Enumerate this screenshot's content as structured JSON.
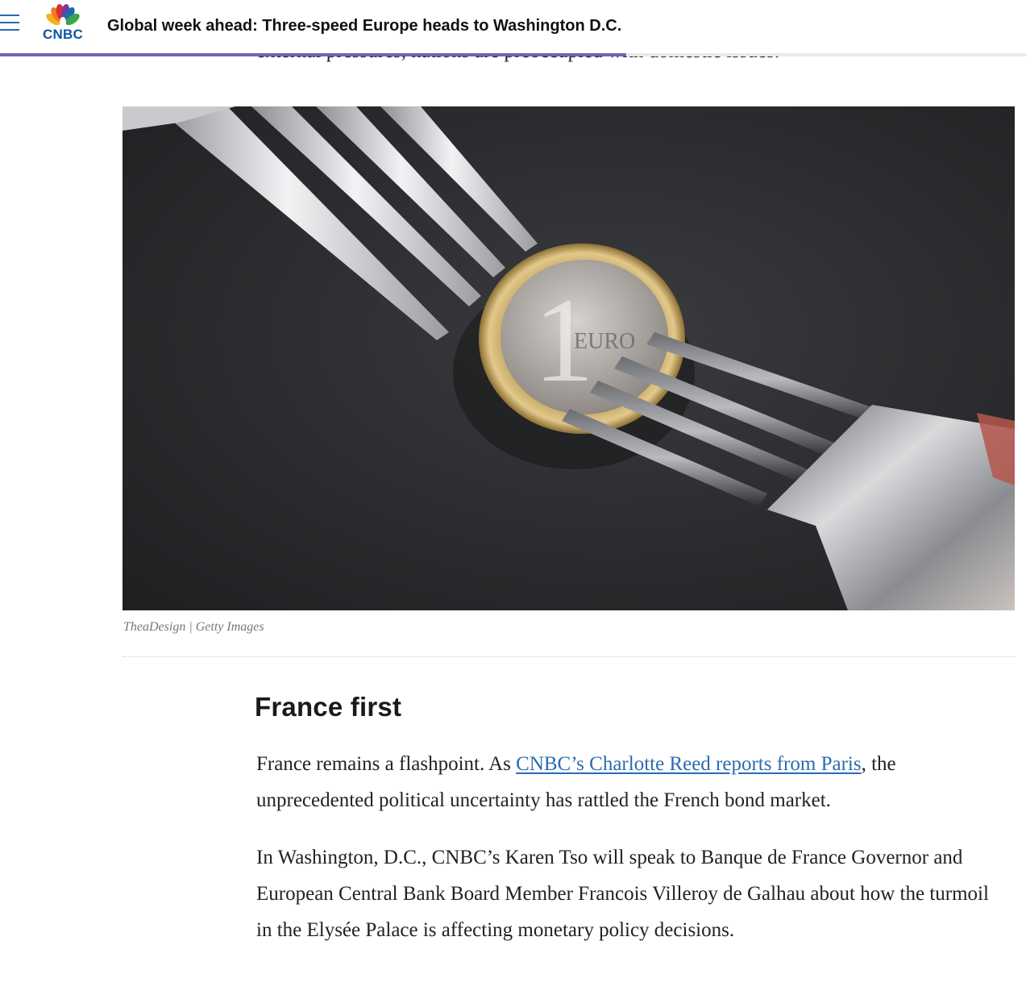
{
  "header": {
    "logo_text": "CNBC",
    "title": "Global week ahead: Three-speed Europe heads to Washington D.C.",
    "reading_progress_percent": 61
  },
  "article": {
    "previous_line": "external pressures, nations are preoccupied with domestic issues.",
    "image_caption": "TheaDesign | Getty Images",
    "section_heading": "France first",
    "paragraph1": {
      "before_link": "France remains a flashpoint. As ",
      "link_text": "CNBC’s Charlotte Reed reports from Paris",
      "after_link": ", the unprecedented political uncertainty has rattled the French bond market."
    },
    "paragraph2": "In Washington, D.C., CNBC’s Karen Tso will speak to Banque de France Governor and European Central Bank Board Member Francois Villeroy de Galhau about how the turmoil in the Elysée Palace is affecting monetary policy decisions."
  },
  "colors": {
    "progress": "#7062b6",
    "link": "#2b6cb0",
    "logo_blue": "#0b57a4"
  }
}
